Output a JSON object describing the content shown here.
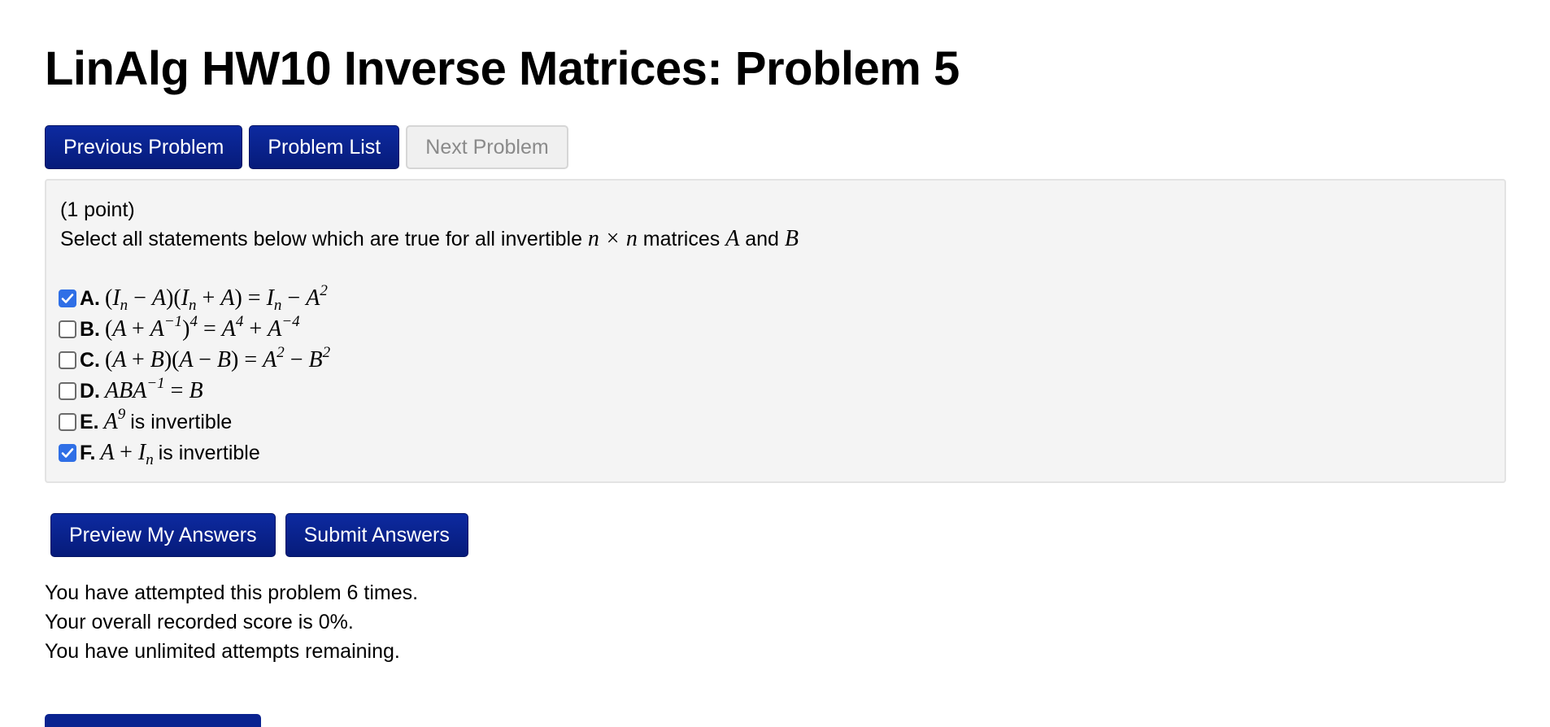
{
  "page": {
    "title": "LinAlg HW10 Inverse Matrices: Problem 5"
  },
  "nav": {
    "previous_label": "Previous Problem",
    "list_label": "Problem List",
    "next_label": "Next Problem"
  },
  "problem": {
    "points": "(1 point)",
    "prompt_text_1": "Select all statements below which are true for all invertible ",
    "prompt_math_1": "n × n",
    "prompt_text_2": " matrices ",
    "prompt_math_2": "A",
    "prompt_text_3": " and ",
    "prompt_math_3": "B",
    "options": [
      {
        "letter": "A.",
        "checked": true,
        "statement": "(I_n − A)(I_n + A) = I_n − A^2"
      },
      {
        "letter": "B.",
        "checked": false,
        "statement": "(A + A^{−1})^4 = A^4 + A^{−4}"
      },
      {
        "letter": "C.",
        "checked": false,
        "statement": "(A + B)(A − B) = A^2 − B^2"
      },
      {
        "letter": "D.",
        "checked": false,
        "statement": "ABA^{−1} = B"
      },
      {
        "letter": "E.",
        "checked": false,
        "statement": "A^9",
        "suffix": "is invertible"
      },
      {
        "letter": "F.",
        "checked": true,
        "statement": "A + I_n",
        "suffix": "is invertible"
      }
    ]
  },
  "actions": {
    "preview_label": "Preview My Answers",
    "submit_label": "Submit Answers"
  },
  "status": {
    "attempts_line": "You have attempted this problem 6 times.",
    "score_line": "Your overall recorded score is 0%.",
    "remaining_line": "You have unlimited attempts remaining."
  },
  "colors": {
    "button_primary": "#0a2390",
    "checkbox_checked": "#2f6fe6",
    "problem_background": "#f4f4f4"
  }
}
